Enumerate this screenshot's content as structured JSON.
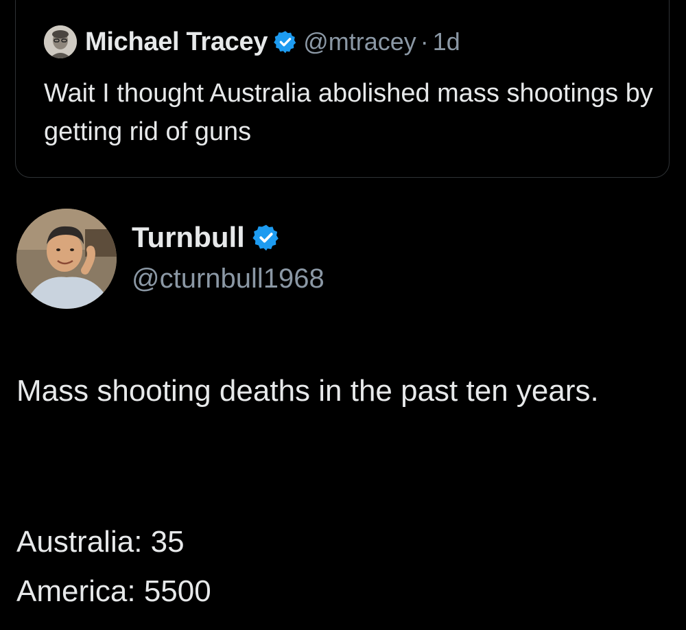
{
  "quoted_tweet": {
    "author_name": "Michael Tracey",
    "verified_icon": "verified-badge-icon",
    "handle": "@mtracey",
    "separator": "·",
    "time": "1d",
    "text": "Wait I thought Australia abolished mass shootings by getting rid of guns"
  },
  "tweet": {
    "author_name": "Turnbull",
    "verified_icon": "verified-badge-icon",
    "handle": "@cturnbull1968",
    "body": "Mass shooting deaths in the past ten years.",
    "stats": [
      {
        "text": "Australia: 35"
      },
      {
        "text": "America: 5500"
      }
    ]
  },
  "colors": {
    "background": "#000000",
    "primary_text": "#e7e9ea",
    "secondary_text": "#8b98a5",
    "verified_blue": "#1d9bf0",
    "card_border": "#2f3336"
  }
}
